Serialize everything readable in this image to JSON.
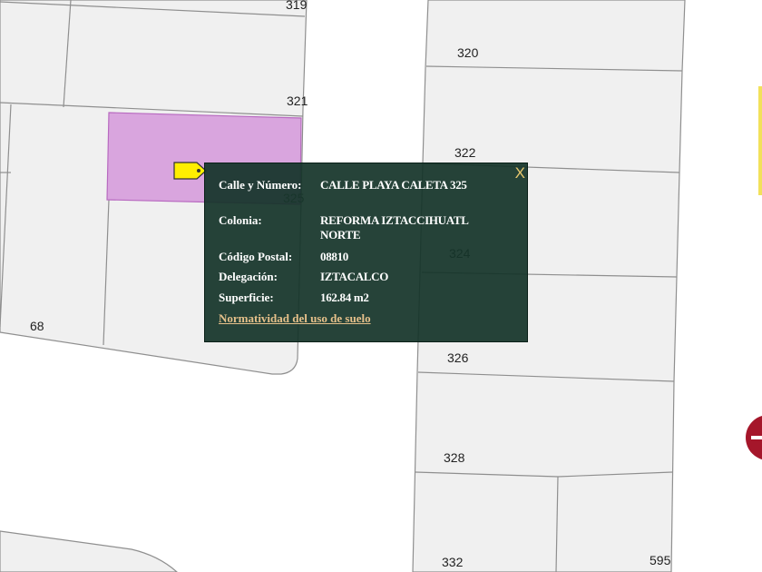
{
  "map": {
    "lot_labels": [
      "319",
      "320",
      "321",
      "322",
      "325",
      "324",
      "68",
      "326",
      "328",
      "332",
      "595"
    ],
    "colors": {
      "background": "#ffffff",
      "block_fill": "#f0f0f0",
      "lot_lines": "#9a9a9a",
      "selected_lot": "#d9a5de",
      "selected_outline": "#b86ac0",
      "marker": "#ffee00",
      "popup_bg": "#133328",
      "popup_link": "#e5c08a"
    }
  },
  "popup": {
    "close_label": "X",
    "fields": [
      {
        "label": "Calle y Número:",
        "value": "CALLE PLAYA CALETA 325"
      },
      {
        "label": "Colonia:",
        "value": "REFORMA IZTACCIHUATL NORTE"
      },
      {
        "label": "Código Postal:",
        "value": "08810"
      },
      {
        "label": "Delegación:",
        "value": "IZTACALCO"
      },
      {
        "label": "Superficie:",
        "value": "162.84 m2"
      }
    ],
    "link_label": "Normatividad del uso de suelo"
  }
}
